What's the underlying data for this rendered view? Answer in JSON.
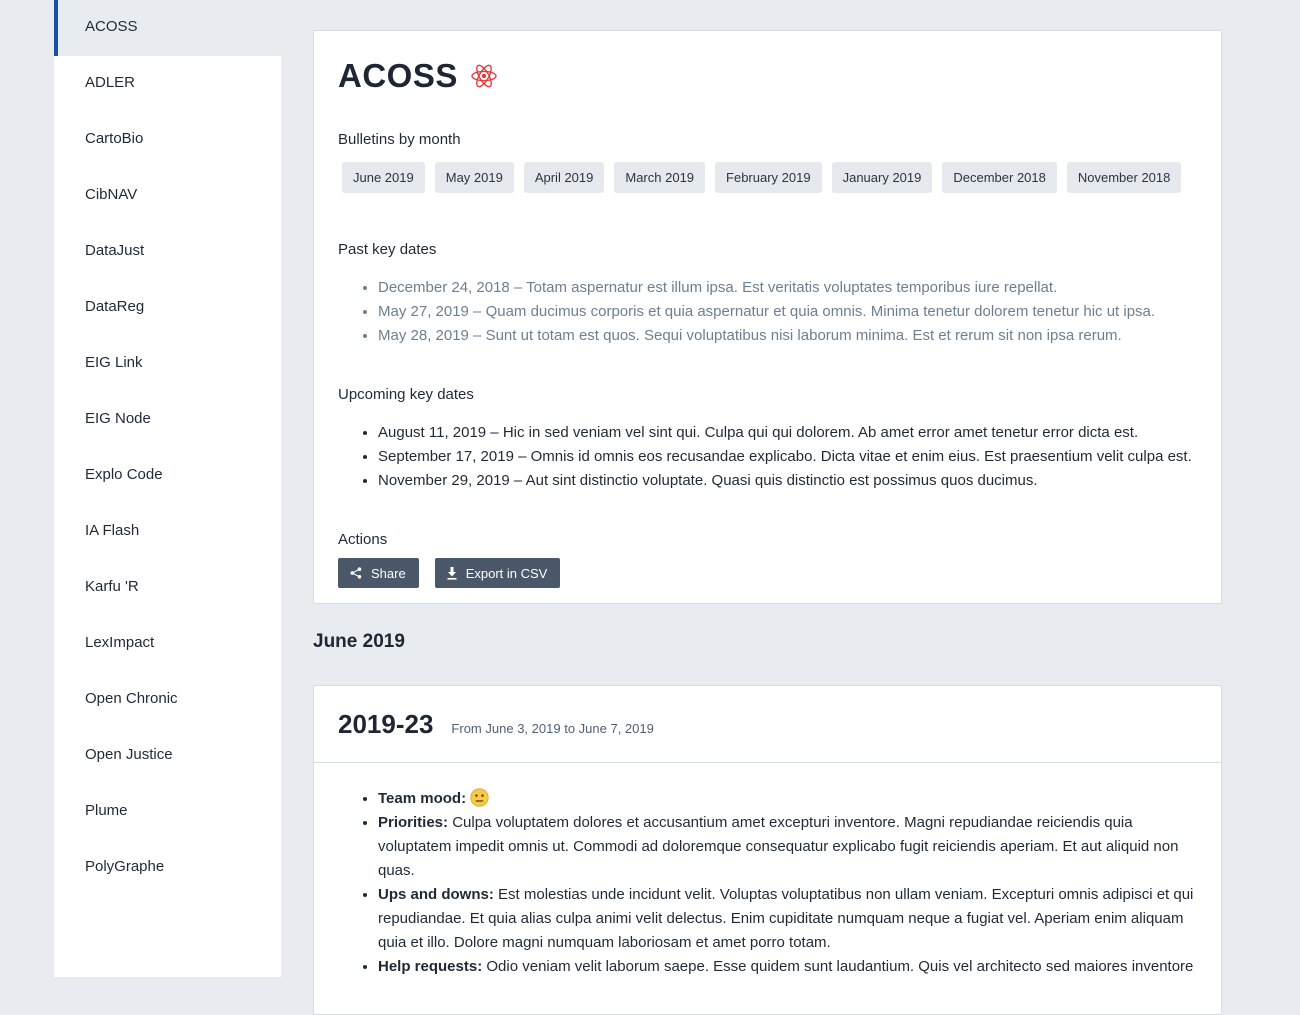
{
  "sidebar": {
    "items": [
      {
        "label": "ACOSS",
        "active": true
      },
      {
        "label": "ADLER"
      },
      {
        "label": "CartoBio"
      },
      {
        "label": "CibNAV"
      },
      {
        "label": "DataJust"
      },
      {
        "label": "DataReg"
      },
      {
        "label": "EIG Link"
      },
      {
        "label": "EIG Node"
      },
      {
        "label": "Explo Code"
      },
      {
        "label": "IA Flash"
      },
      {
        "label": "Karfu 'R"
      },
      {
        "label": "LexImpact"
      },
      {
        "label": "Open Chronic"
      },
      {
        "label": "Open Justice"
      },
      {
        "label": "Plume"
      },
      {
        "label": "PolyGraphe"
      }
    ]
  },
  "project": {
    "title": "ACOSS",
    "icon": "atom-icon",
    "bulletins_label": "Bulletins by month",
    "months": [
      "June 2019",
      "May 2019",
      "April 2019",
      "March 2019",
      "February 2019",
      "January 2019",
      "December 2018",
      "November 2018"
    ],
    "past_label": "Past key dates",
    "past_dates": [
      "December 24, 2018 – Totam aspernatur est illum ipsa. Est veritatis voluptates temporibus iure repellat.",
      "May 27, 2019 – Quam ducimus corporis et quia aspernatur et quia omnis. Minima tenetur dolorem tenetur hic ut ipsa.",
      "May 28, 2019 – Sunt ut totam est quos. Sequi voluptatibus nisi laborum minima. Est et rerum sit non ipsa rerum."
    ],
    "upcoming_label": "Upcoming key dates",
    "upcoming_dates": [
      "August 11, 2019 – Hic in sed veniam vel sint qui. Culpa qui qui dolorem. Ab amet error amet tenetur error dicta est.",
      "September 17, 2019 – Omnis id omnis eos recusandae explicabo. Dicta vitae et enim eius. Est praesentium velit culpa est.",
      "November 29, 2019 – Aut sint distinctio voluptate. Quasi quis distinctio est possimus quos ducimus."
    ],
    "actions_label": "Actions",
    "share_label": "Share",
    "export_label": "Export in CSV"
  },
  "month_section": {
    "heading": "June 2019",
    "week": {
      "number": "2019-23",
      "from_word": "From",
      "start": "June 3, 2019",
      "to_word": "to",
      "end": "June 7, 2019",
      "mood_label": "Team mood:",
      "mood_icon": "neutral-face-icon",
      "priorities_label": "Priorities:",
      "priorities_text": "Culpa voluptatem dolores et accusantium amet excepturi inventore. Magni repudiandae reiciendis quia voluptatem impedit omnis ut. Commodi ad doloremque consequatur explicabo fugit reiciendis aperiam. Et aut aliquid non quas.",
      "ups_label": "Ups and downs:",
      "ups_text": "Est molestias unde incidunt velit. Voluptas voluptatibus non ullam veniam. Excepturi omnis adipisci et qui repudiandae. Et quia alias culpa animi velit delectus. Enim cupiditate numquam neque a fugiat vel. Aperiam enim aliquam quia et illo. Dolore magni numquam laboriosam et amet porro totam.",
      "help_label": "Help requests:",
      "help_text": "Odio veniam velit laborum saepe. Esse quidem sunt laudantium. Quis vel architecto sed maiores inventore"
    }
  },
  "colors": {
    "accent": "#1452a3",
    "button": "#4b5869",
    "background": "#e8ecf1",
    "muted_text": "#6d7f93",
    "atom_icon": "#e5383b"
  }
}
